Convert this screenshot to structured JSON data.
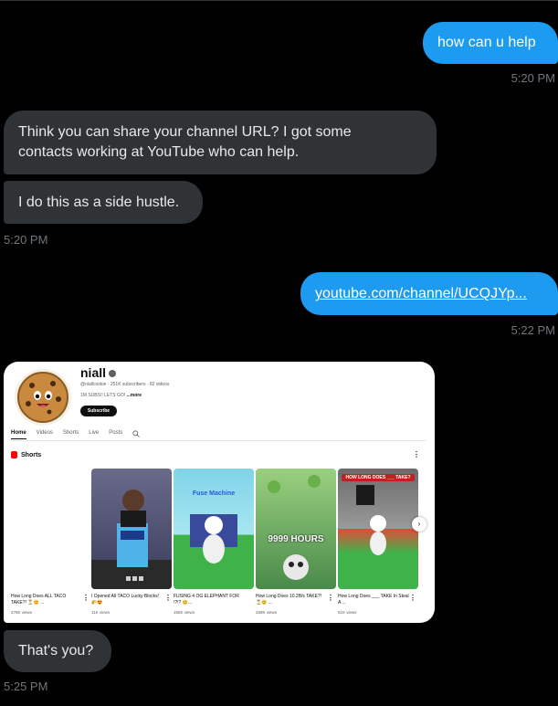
{
  "messages": {
    "m1": "how can u help",
    "t1": "5:20 PM",
    "m2_line1": "Think you can share your channel URL? I got some",
    "m2_line2": "contacts working at YouTube who can help.",
    "m3": "I do this as a side hustle.",
    "t2": "5:20 PM",
    "m4": "youtube.com/channel/UCQJYp...",
    "t3": "5:22 PM",
    "m5": "That's you?",
    "t4": "5:25 PM"
  },
  "channel": {
    "name": "niall",
    "handle_meta": "@niallcookie · 251K subscribers · 82 videos",
    "description": "1M SUBS!! LETS GO! ",
    "more": "...more",
    "subscribe": "Subscribe",
    "tabs": [
      "Home",
      "Videos",
      "Shorts",
      "Live",
      "Posts"
    ],
    "section_title": "Shorts",
    "shorts": [
      {
        "title": "How Long Does ALL TACO TAKE?! ⏳😊 ...",
        "views": "278K views"
      },
      {
        "title": "I Opened All TACO Lucky Blocks! 🌮😍",
        "views": "11K views",
        "thumb_text": ""
      },
      {
        "title": "FUSING 4 OG ELEPHANT FOR !?!? 😊...",
        "views": "165K views",
        "thumb_text": "Fuse Machine"
      },
      {
        "title": "How Long Does 10.2B/s TAKE?! ⏳😊 ...",
        "views": "268K views",
        "thumb_text": "9999 HOURS"
      },
      {
        "title": "How Long Does ___ TAKE In Steal A ...",
        "views": "61K views",
        "thumb_text": "HOW LONG DOES ___ TAKE?"
      }
    ]
  },
  "colors": {
    "outgoing": "#1d9bf0",
    "incoming": "#2f3336",
    "background": "#000000"
  }
}
